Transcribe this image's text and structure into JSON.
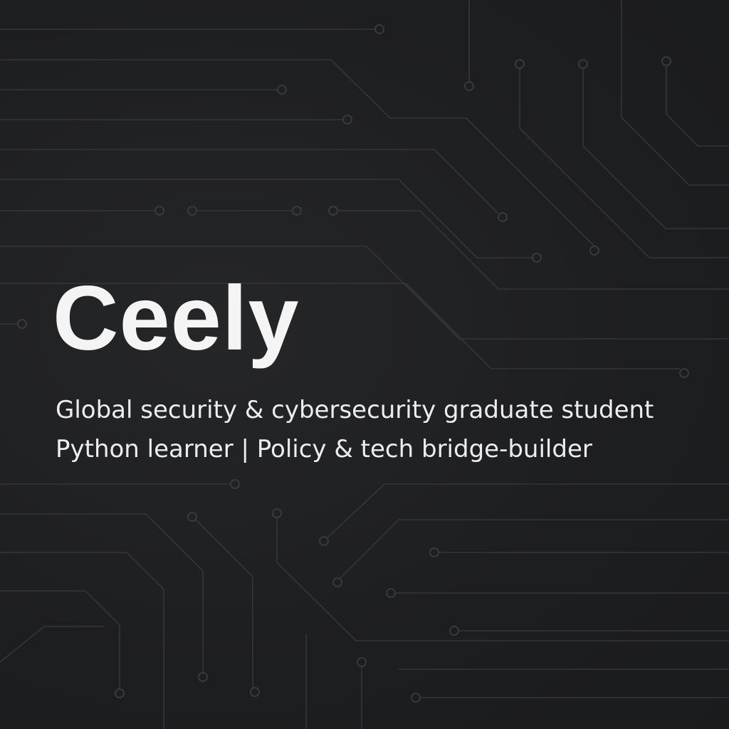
{
  "profile": {
    "name": "Ceely",
    "tagline_1": "Global security & cybersecurity graduate student",
    "tagline_2": "Python learner | Policy & tech bridge-builder"
  },
  "theme": {
    "background": "#1e1f21",
    "circuit_line": "#34363a",
    "text": "#f4f4f4"
  },
  "decoration": "circuit-board-pattern"
}
